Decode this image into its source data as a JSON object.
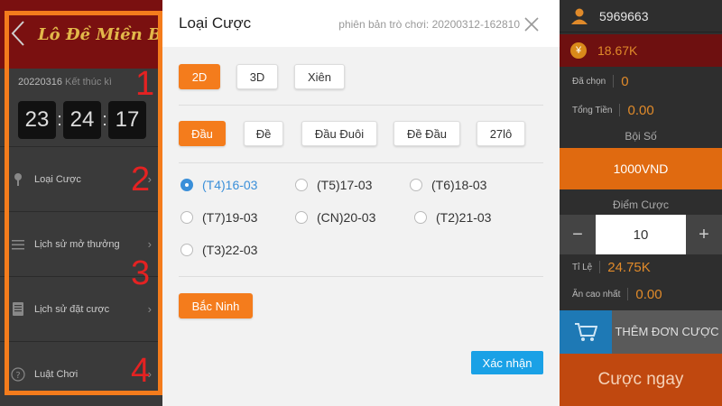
{
  "left_panel": {
    "title": "Lô Đề Miền Bắc",
    "draw_date": "20220316",
    "draw_status": "Kết thúc kì",
    "timer": {
      "hours": "23",
      "minutes": "24",
      "seconds": "17"
    },
    "menu": [
      {
        "label": "Loại Cược",
        "icon": "pin-icon"
      },
      {
        "label": "Lịch sử mở thưởng",
        "icon": "list-icon"
      },
      {
        "label": "Lịch sử đặt cược",
        "icon": "document-icon"
      },
      {
        "label": "Luật Chơi",
        "icon": "question-icon"
      }
    ],
    "annotations": [
      "1",
      "2",
      "3",
      "4"
    ],
    "accent": "#f47c1c"
  },
  "modal": {
    "title": "Loại Cược",
    "version": "phiên bản trò chơi: 20200312-162810",
    "game_types": [
      {
        "label": "2D",
        "active": true
      },
      {
        "label": "3D",
        "active": false
      },
      {
        "label": "Xiên",
        "active": false
      }
    ],
    "bet_types": [
      {
        "label": "Đầu",
        "active": true
      },
      {
        "label": "Đề",
        "active": false
      },
      {
        "label": "Đầu Đuôi",
        "active": false
      },
      {
        "label": "Đề Đầu",
        "active": false
      },
      {
        "label": "27lô",
        "active": false
      }
    ],
    "dates": [
      {
        "label": "(T4)16-03",
        "selected": true
      },
      {
        "label": "(T5)17-03",
        "selected": false
      },
      {
        "label": "(T6)18-03",
        "selected": false
      },
      {
        "label": "(T7)19-03",
        "selected": false
      },
      {
        "label": "(CN)20-03",
        "selected": false
      },
      {
        "label": "(T2)21-03",
        "selected": false
      },
      {
        "label": "(T3)22-03",
        "selected": false
      }
    ],
    "region": {
      "label": "Bắc Ninh",
      "active": true
    },
    "confirm_label": "Xác nhận"
  },
  "right_panel": {
    "user_id": "5969663",
    "balance": "18.67K",
    "selected_label": "Đã chọn",
    "selected_value": "0",
    "total_label": "Tổng Tiền",
    "total_value": "0.00",
    "multiplier_label": "Bội Số",
    "multiplier_value": "1000VND",
    "points_label": "Điểm Cược",
    "points_value": "10",
    "minus": "−",
    "plus": "+",
    "ratio_label": "Tỉ Lệ",
    "ratio_value": "24.75K",
    "max_win_label": "Ăn cao nhất",
    "max_win_value": "0.00",
    "add_order_label": "THÊM ĐƠN CƯỢC",
    "bet_now_label": "Cược ngay"
  }
}
